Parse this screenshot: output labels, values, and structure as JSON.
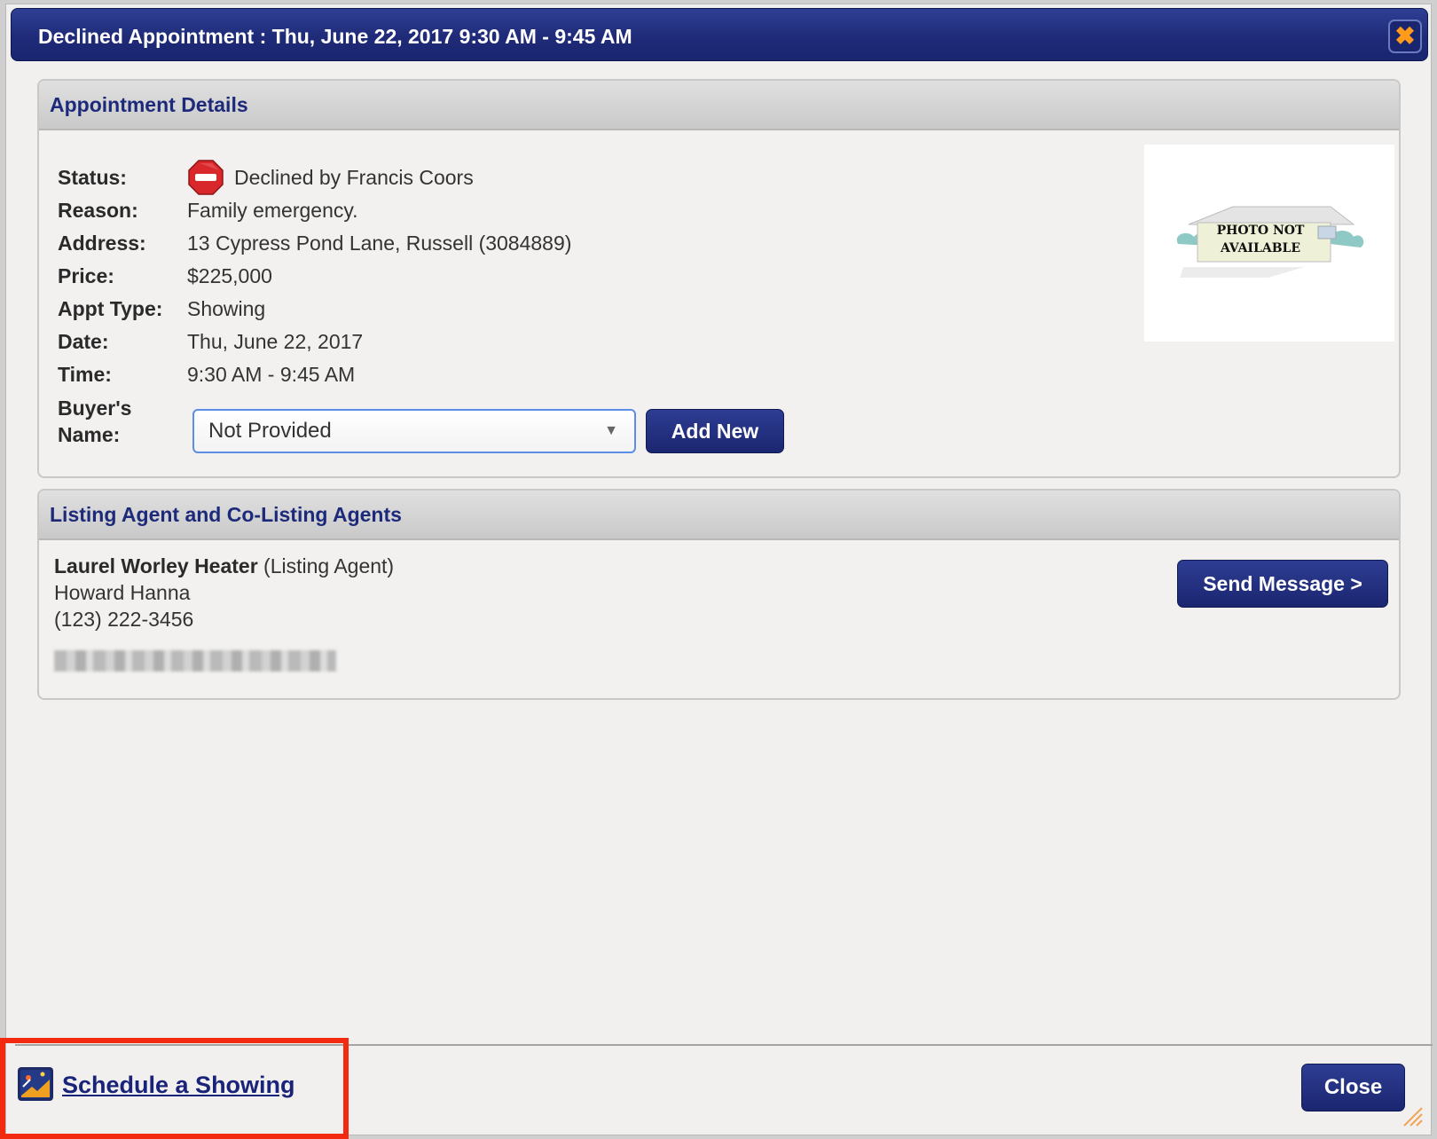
{
  "dialog": {
    "title": "Declined Appointment : Thu, June 22, 2017 9:30 AM - 9:45 AM",
    "close_glyph": "✖"
  },
  "details": {
    "header": "Appointment Details",
    "status_label": "Status:",
    "status_value": "Declined by Francis Coors",
    "reason_label": "Reason:",
    "reason_value": "Family emergency.",
    "address_label": "Address:",
    "address_value": "13 Cypress Pond Lane, Russell (3084889)",
    "price_label": "Price:",
    "price_value": "$225,000",
    "appt_type_label": "Appt Type:",
    "appt_type_value": "Showing",
    "date_label": "Date:",
    "date_value": "Thu, June 22, 2017",
    "time_label": "Time:",
    "time_value": "9:30 AM - 9:45 AM",
    "buyer_label_1": "Buyer's",
    "buyer_label_2": "Name:",
    "buyer_select_value": "Not Provided",
    "add_new_label": "Add New",
    "photo_text_1": "PHOTO NOT",
    "photo_text_2": "AVAILABLE"
  },
  "agents": {
    "header": "Listing Agent and Co-Listing Agents",
    "name": "Laurel Worley Heater",
    "role": " (Listing Agent)",
    "company": "Howard Hanna",
    "phone": "(123) 222-3456",
    "send_message_label": "Send Message >"
  },
  "footer": {
    "schedule_label": "Schedule a Showing",
    "close_label": "Close"
  },
  "colors": {
    "accent": "#1f2b78",
    "highlight": "#f22a10",
    "declined_icon": "#d8282b"
  },
  "icons": [
    "close-icon",
    "declined-stop-icon",
    "dropdown-arrow-icon",
    "schedule-showing-icon",
    "resize-grip-icon"
  ]
}
